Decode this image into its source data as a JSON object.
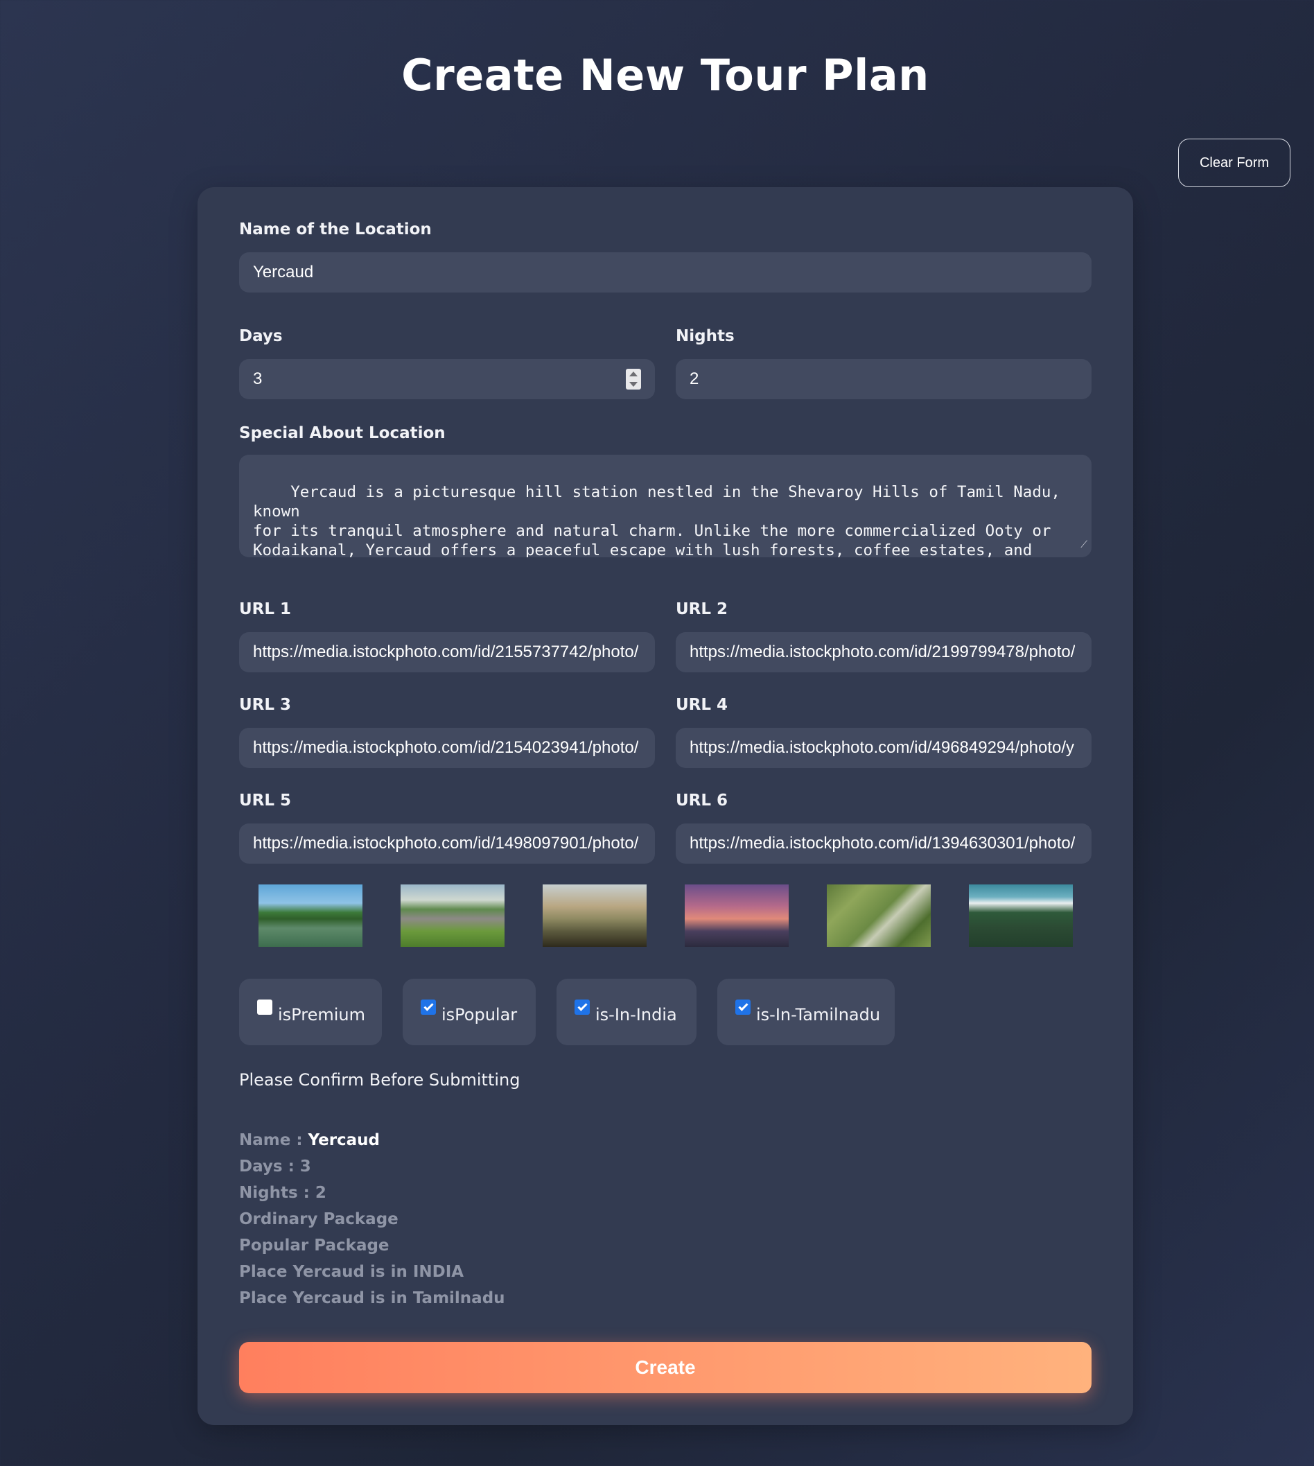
{
  "page": {
    "title": "Create New Tour Plan"
  },
  "toolbar": {
    "clear_label": "Clear Form"
  },
  "form": {
    "location": {
      "label": "Name of the Location",
      "value": "Yercaud"
    },
    "days": {
      "label": "Days",
      "value": "3"
    },
    "nights": {
      "label": "Nights",
      "value": "2"
    },
    "special": {
      "label": "Special About Location",
      "value": "Yercaud is a picturesque hill station nestled in the Shevaroy Hills of Tamil Nadu, known\nfor its tranquil atmosphere and natural charm. Unlike the more commercialized Ooty or\nKodaikanal, Yercaud offers a peaceful escape with lush forests, coffee estates, and orange\ngroves. The cool climate makes it an ideal year-round destination, especially during\nsummer. Popular attractions include the serene Yercaud Lake, scenic viewpoints like Lady’s"
    },
    "urls": [
      {
        "label": "URL 1",
        "value": "https://media.istockphoto.com/id/2155737742/photo/"
      },
      {
        "label": "URL 2",
        "value": "https://media.istockphoto.com/id/2199799478/photo/"
      },
      {
        "label": "URL 3",
        "value": "https://media.istockphoto.com/id/2154023941/photo/"
      },
      {
        "label": "URL 4",
        "value": "https://media.istockphoto.com/id/496849294/photo/y"
      },
      {
        "label": "URL 5",
        "value": "https://media.istockphoto.com/id/1498097901/photo/"
      },
      {
        "label": "URL 6",
        "value": "https://media.istockphoto.com/id/1394630301/photo/"
      }
    ],
    "flags": [
      {
        "label": "isPremium",
        "checked": false
      },
      {
        "label": "isPopular",
        "checked": true
      },
      {
        "label": "is-In-India",
        "checked": true
      },
      {
        "label": "is-In-Tamilnadu",
        "checked": true
      }
    ],
    "confirm_text": "Please Confirm Before Submitting",
    "summary": {
      "name_prefix": "Name : ",
      "name_value": "Yercaud",
      "days": "Days : 3",
      "nights": "Nights : 2",
      "package1": "Ordinary Package",
      "package2": "Popular Package",
      "india": "Place Yercaud is in INDIA",
      "tamilnadu": "Place Yercaud is in Tamilnadu"
    },
    "submit_label": "Create"
  },
  "colors": {
    "accent_start": "#ff7f5e",
    "accent_end": "#ffb27d",
    "checkbox_checked": "#1f73e8",
    "card_bg": "#333b51",
    "input_bg": "#424a60"
  }
}
